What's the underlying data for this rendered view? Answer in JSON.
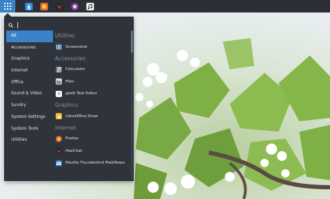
{
  "panel": {
    "launchers": [
      {
        "name": "download-icon",
        "color": "#2d8ee0"
      },
      {
        "name": "firefox-icon",
        "color": "#e66a2c"
      },
      {
        "name": "hexchat-icon",
        "color": "#d4332d"
      },
      {
        "name": "media-player-icon",
        "color": "#9b4fb0"
      },
      {
        "name": "music-icon",
        "color": "#f2f2f2"
      }
    ]
  },
  "search": {
    "value": "",
    "placeholder": ""
  },
  "categories": [
    {
      "label": "All",
      "selected": true
    },
    {
      "label": "Accessories"
    },
    {
      "label": "Graphics"
    },
    {
      "label": "Internet"
    },
    {
      "label": "Office"
    },
    {
      "label": "Sound & Video"
    },
    {
      "label": "Sundry"
    },
    {
      "label": "System Settings"
    },
    {
      "label": "System Tools"
    },
    {
      "label": "Utilities"
    }
  ],
  "apps": {
    "utilities_title": "Utilities",
    "screenshot": "Screenshot",
    "accessories_title": "Accessories",
    "calculator": "Calculator",
    "files": "Files",
    "gedit": "gedit Text Editor",
    "graphics_title": "Graphics",
    "draw": "LibreOffice Draw",
    "internet_title": "Internet",
    "firefox": "Firefox",
    "hexchat": "HexChat",
    "thunderbird": "Mozilla Thunderbird Mail/News"
  },
  "colors": {
    "panel": "#2b2e36",
    "menu": "#2f333c",
    "accent": "#3b83c9"
  }
}
